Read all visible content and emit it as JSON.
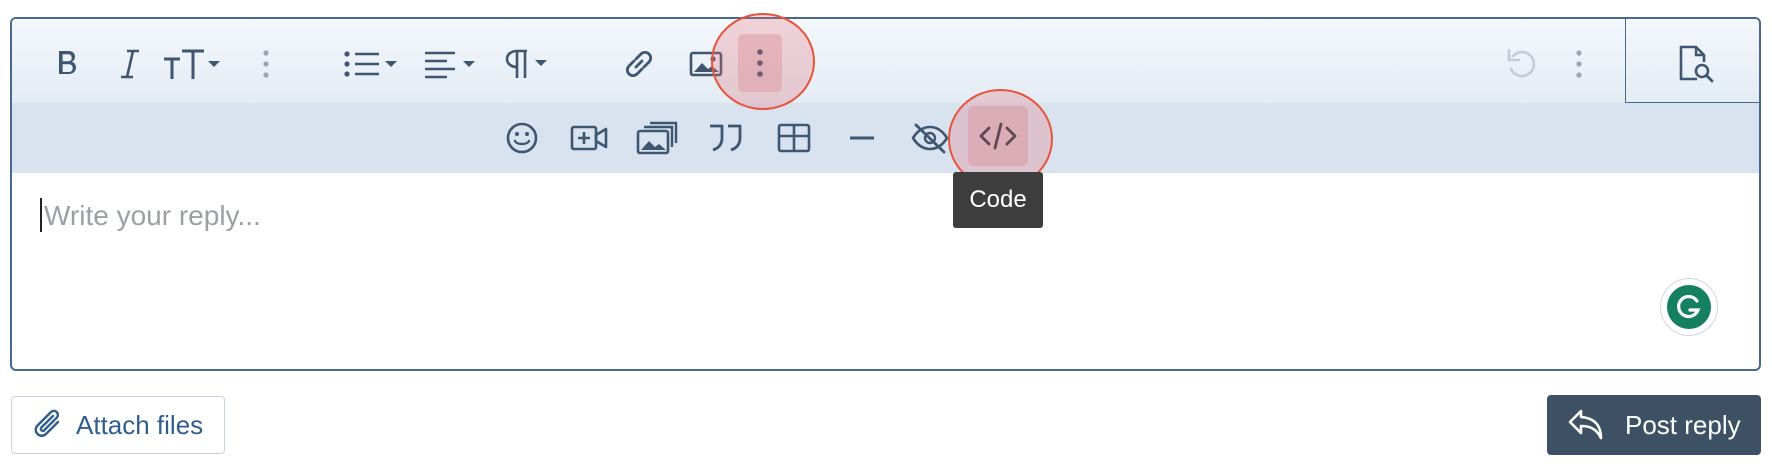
{
  "editor": {
    "placeholder": "Write your reply...",
    "toolbar_row1": [
      {
        "name": "bold-icon"
      },
      {
        "name": "italic-icon"
      },
      {
        "name": "font-size-icon"
      },
      {
        "name": "more-text-icon"
      },
      {
        "name": "list-icon"
      },
      {
        "name": "align-icon"
      },
      {
        "name": "paragraph-icon"
      },
      {
        "name": "link-icon"
      },
      {
        "name": "image-icon"
      },
      {
        "name": "more-insert-icon"
      },
      {
        "name": "undo-icon"
      },
      {
        "name": "more-misc-icon"
      },
      {
        "name": "preview-icon"
      }
    ],
    "toolbar_row2": [
      {
        "name": "smilie-icon"
      },
      {
        "name": "media-icon"
      },
      {
        "name": "gallery-icon"
      },
      {
        "name": "quote-icon"
      },
      {
        "name": "table-icon"
      },
      {
        "name": "horizontal-line-icon"
      },
      {
        "name": "spoiler-icon"
      },
      {
        "name": "code-icon"
      }
    ],
    "tooltip": "Code"
  },
  "footer": {
    "attach_label": "Attach files",
    "post_label": "Post reply"
  },
  "colors": {
    "border": "#47688f",
    "toolbar_icon": "#3f5670",
    "highlight_ring": "#e8533c",
    "post_button": "#3e5064",
    "attach_text": "#2f5d8e",
    "grammarly": "#15805f"
  }
}
